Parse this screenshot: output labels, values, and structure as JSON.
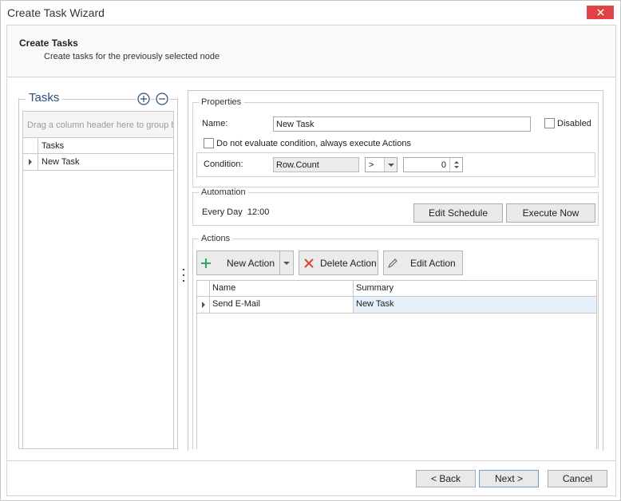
{
  "window": {
    "title": "Create Task Wizard"
  },
  "header": {
    "title": "Create Tasks",
    "subtitle": "Create tasks for the previously selected node"
  },
  "tasks": {
    "title": "Tasks",
    "group_hint": "Drag a column header here to group by that column",
    "column": "Tasks",
    "rows": [
      "New Task"
    ]
  },
  "properties": {
    "group_label": "Properties",
    "name_label": "Name:",
    "name_value": "New Task",
    "disabled_label": "Disabled",
    "no_eval_label": "Do not evaluate condition, always execute Actions",
    "condition_label": "Condition:",
    "condition_field": "Row.Count",
    "operator": ">",
    "condition_value": "0"
  },
  "automation": {
    "group_label": "Automation",
    "schedule_text": "Every Day  12:00",
    "edit_schedule": "Edit Schedule",
    "execute_now": "Execute Now"
  },
  "actions": {
    "group_label": "Actions",
    "new_action": "New Action",
    "delete_action": "Delete Action",
    "edit_action": "Edit Action",
    "columns": [
      "Name",
      "Summary"
    ],
    "rows": [
      {
        "name": "Send E-Mail",
        "summary": "New Task"
      }
    ]
  },
  "footer": {
    "back": "< Back",
    "next": "Next >",
    "cancel": "Cancel"
  },
  "colors": {
    "close": "#e04343",
    "accent": "#2c4f7a",
    "add": "#2eaa5c",
    "delete": "#d9453b"
  }
}
